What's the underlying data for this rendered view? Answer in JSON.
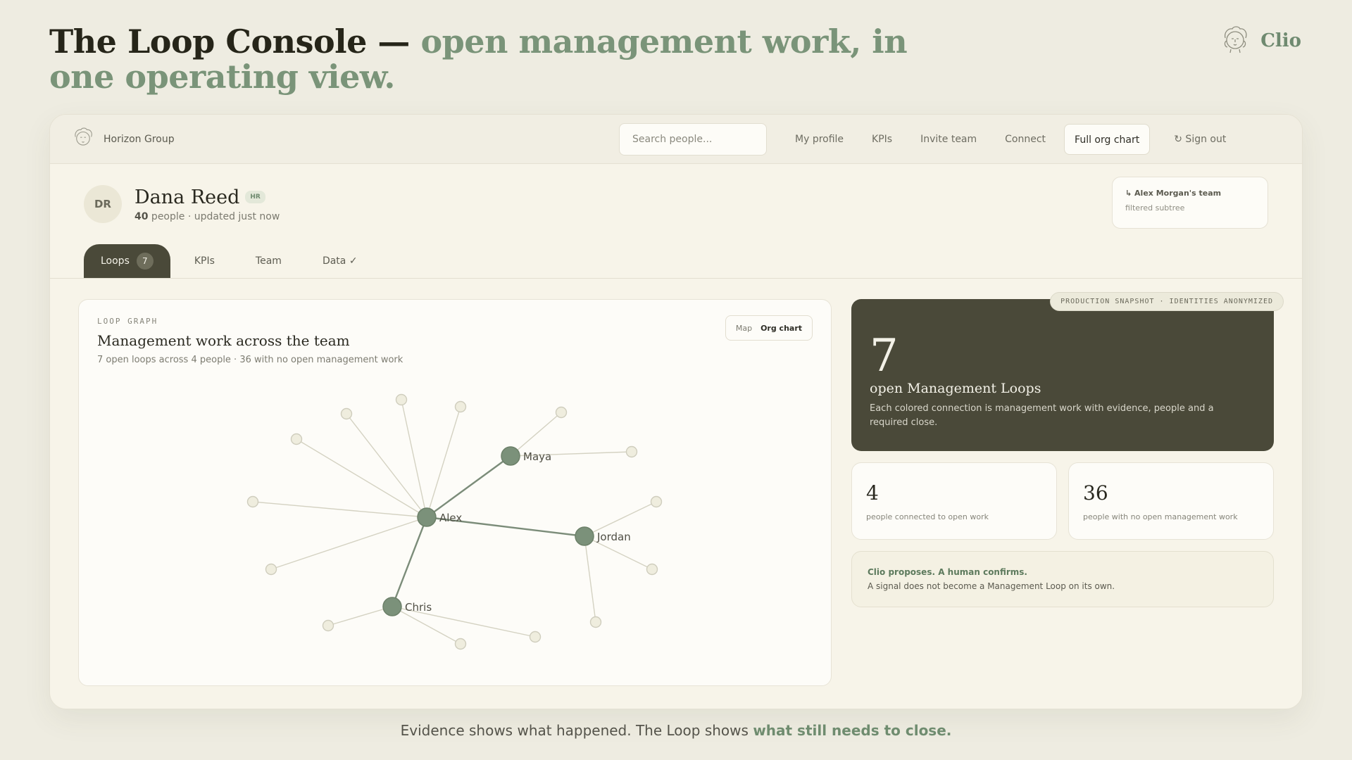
{
  "headline": {
    "lead": "The Loop Console — ",
    "accent": "open management work, in one operating view."
  },
  "brand": {
    "name": "Clio",
    "icon": "clio-face-logo-icon"
  },
  "topbar": {
    "org_name": "Horizon Group",
    "search_placeholder": "Search people...",
    "nav": {
      "my_profile": "My profile",
      "kpis": "KPIs",
      "invite_team": "Invite team",
      "connect": "Connect",
      "full_org_chart": "Full org chart",
      "sign_out": "↻ Sign out"
    }
  },
  "profile": {
    "initials": "DR",
    "name": "Dana Reed",
    "role_badge": "HR",
    "people_count": "40",
    "meta_suffix": " people · updated just now"
  },
  "team_filter": {
    "title": "↳ Alex Morgan's team",
    "subtitle": "filtered subtree"
  },
  "tabs": {
    "loops_label": "Loops",
    "loops_count": "7",
    "kpis_label": "KPIs",
    "team_label": "Team",
    "data_label": "Data ✓"
  },
  "graph_card": {
    "eyebrow": "LOOP GRAPH",
    "title": "Management work across the team",
    "subtitle": "7 open loops across 4 people · 36 with no open management work",
    "toggle": {
      "map": "Map",
      "org_chart": "Org chart",
      "selected": "Org chart"
    }
  },
  "hero": {
    "snapshot_label": "PRODUCTION SNAPSHOT · IDENTITIES ANONYMIZED",
    "number": "7",
    "label": "open Management Loops",
    "description": "Each colored connection is management work with evidence, people and a required close."
  },
  "stats": [
    {
      "number": "4",
      "label": "people connected to open work"
    },
    {
      "number": "36",
      "label": "people with no open management work"
    }
  ],
  "note": {
    "title": "Clio proposes. A human confirms.",
    "text": "A signal does not become a Management Loop on its own."
  },
  "footer": {
    "lead": "Evidence shows what happened. The Loop shows ",
    "accent": "what still needs to close."
  },
  "colors": {
    "accent_green": "#7a9479",
    "dark_panel": "#4a4939",
    "node_main": "#7b917a",
    "node_leaf": "#efedde",
    "background": "#eeece1"
  },
  "graph": {
    "main_nodes": [
      {
        "id": "alex",
        "label": "Alex"
      },
      {
        "id": "maya",
        "label": "Maya"
      },
      {
        "id": "jordan",
        "label": "Jordan"
      },
      {
        "id": "chris",
        "label": "Chris"
      }
    ],
    "loop_edges": [
      [
        "alex",
        "maya"
      ],
      [
        "alex",
        "jordan"
      ],
      [
        "alex",
        "chris"
      ]
    ]
  }
}
